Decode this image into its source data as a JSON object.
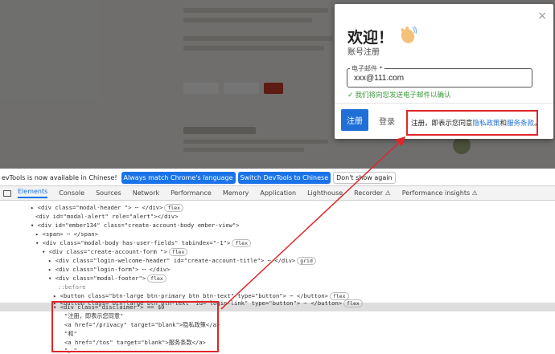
{
  "modal": {
    "title": "欢迎！",
    "subtitle": "账号注册",
    "close_glyph": "×",
    "email_label": "电子邮件 *",
    "email_value": "xxx@111.com",
    "email_hint": "我们将向您发送电子邮件以确认",
    "signup_button": "注册",
    "login_button": "登录",
    "disclaimer_prefix": "注册，即表示您同意",
    "privacy_link": "隐私政策",
    "and_text": "和",
    "tos_link": "服务条款",
    "disclaimer_suffix": "。"
  },
  "devtools_notice": {
    "text": "evTools is now available in Chinese!",
    "btn_match": "Always match Chrome's language",
    "btn_switch": "Switch DevTools to Chinese",
    "btn_dismiss": "Don't show again"
  },
  "tabs": [
    "Elements",
    "Console",
    "Sources",
    "Network",
    "Performance",
    "Memory",
    "Application",
    "Lighthouse",
    "Recorder ⚠",
    "Performance insights ⚠"
  ],
  "dom_lines": [
    "▸ <div class=\"modal-header \"> ⋯ </div>",
    "<div id=\"modal-alert\" role=\"alert\"></div>",
    "▾ <div id=\"ember134\" class=\"create-account-body ember-view\">",
    "▸ <span> ⋯ </span>",
    "▾ <div class=\"modal-body has-user-fields\" tabindex=\"-1\">",
    "▾ <div class=\"create-account-form \">",
    "▸ <div class=\"login-welcome-header\" id=\"create-account-title\"> ⋯ </div>",
    "▸ <div class=\"login-form\"> ⋯ </div>",
    "▾ <div class=\"modal-footer\">",
    "::before",
    "▸ <button class=\"btn-large btn-primary btn btn-text\" type=\"button\"> ⋯ </button>",
    "▸ <button class=\"btn-large btn btn-text\" id=\"login-link\" type=\"button\"> ⋯ </button>",
    "▾ <div class=\"disclaimer\"> == $0",
    "\"注册，即表示您同意\"",
    "<a href=\"/privacy\" target=\"blank\">隐私政策</a>",
    "\"和\"",
    "<a href=\"/tos\" target=\"blank\">服务条款</a>",
    "\"。\""
  ],
  "pills": {
    "flex": "flex",
    "grid": "grid",
    "ellipsis": "⋯"
  },
  "colors": {
    "annotation_red": "#e0262a",
    "primary_blue": "#1f6fd6",
    "hint_green": "#3a9a3a"
  }
}
